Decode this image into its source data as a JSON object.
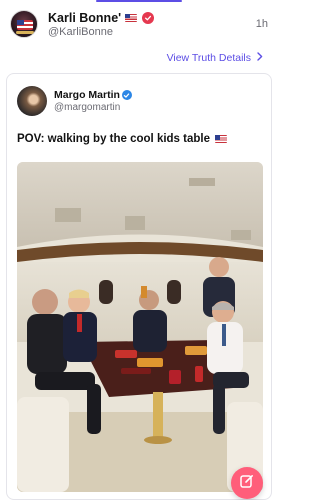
{
  "post": {
    "author_name": "Karli Bonne'",
    "author_handle": "@KarliBonne",
    "time": "1h"
  },
  "view_details": {
    "label": "View Truth Details",
    "icon": "chevron-right-icon"
  },
  "quoted": {
    "author_name": "Margo Martin",
    "author_handle": "@margomartin",
    "text": "POV: walking by the cool kids table"
  },
  "icons": {
    "author_verified": "verified-badge-icon",
    "quoted_verified": "verified-badge-icon",
    "compose": "compose-icon",
    "flag": "us-flag-icon"
  },
  "colors": {
    "accent": "#5c4ee5",
    "verified_red": "#e5384f",
    "verified_blue": "#2b86e6",
    "fab": "#ff5e7a"
  }
}
